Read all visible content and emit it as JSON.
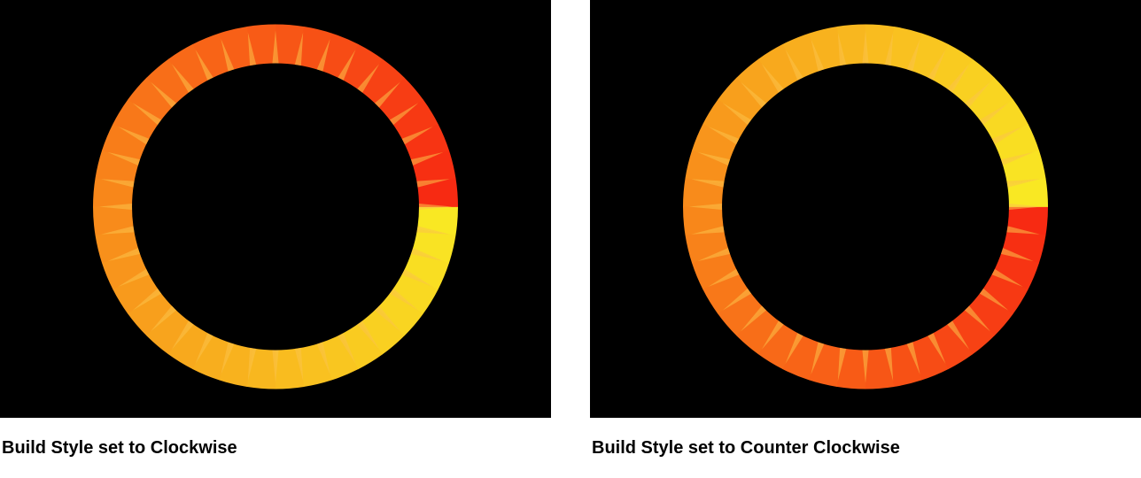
{
  "ring": {
    "segments": 40,
    "outer_radius": 206,
    "inner_radius": 162,
    "colors": {
      "red": "#f72a12",
      "yellow": "#f9e823",
      "tick": "#fcc24a"
    }
  },
  "panels": {
    "left": {
      "caption": "Build Style set to Clockwise",
      "direction": "clockwise"
    },
    "right": {
      "caption": "Build Style set to Counter Clockwise",
      "direction": "counterclockwise"
    }
  }
}
